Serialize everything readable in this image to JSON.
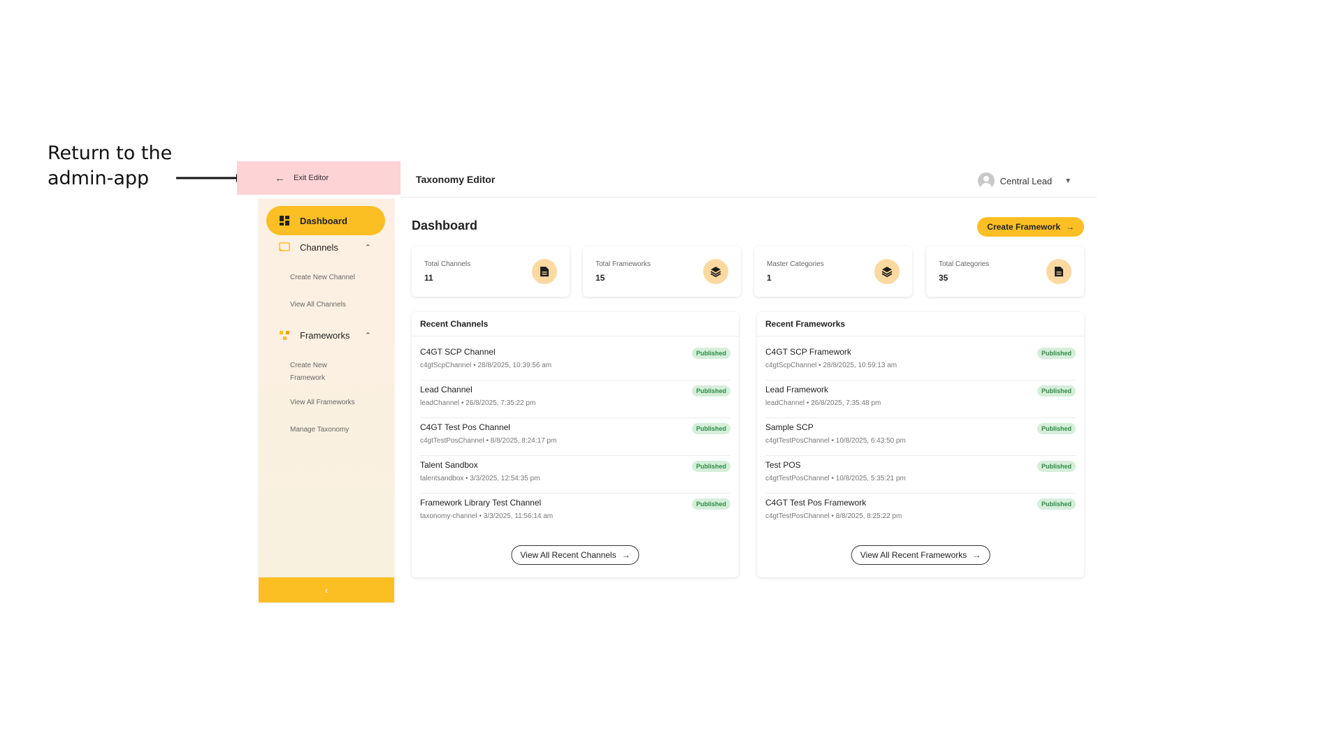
{
  "annotation": {
    "text": "Return to the admin-app"
  },
  "exit_editor": {
    "label": "Exit Editor",
    "icon": "arrow-left-icon"
  },
  "header": {
    "title": "Taxonomy Editor",
    "user_name": "Central Lead"
  },
  "sidebar": {
    "dashboard": "Dashboard",
    "channels": {
      "label": "Channels",
      "sub": [
        "Create New Channel",
        "View All Channels"
      ]
    },
    "frameworks": {
      "label": "Frameworks",
      "sub": [
        "Create New Framework",
        "View All Frameworks",
        "Manage Taxonomy"
      ]
    },
    "collapse_icon": "chevron-left-icon"
  },
  "main": {
    "title": "Dashboard",
    "create_button": "Create Framework",
    "stats": [
      {
        "label": "Total Channels",
        "value": "11",
        "icon": "document-icon"
      },
      {
        "label": "Total Frameworks",
        "value": "15",
        "icon": "layers-icon"
      },
      {
        "label": "Master Categories",
        "value": "1",
        "icon": "layers-icon"
      },
      {
        "label": "Total Categories",
        "value": "35",
        "icon": "document-icon"
      }
    ],
    "recent_channels": {
      "title": "Recent Channels",
      "button": "View All Recent Channels",
      "items": [
        {
          "name": "C4GT SCP Channel",
          "meta": "c4gtScpChannel • 28/8/2025, 10:39:56 am",
          "status": "Published"
        },
        {
          "name": "Lead Channel",
          "meta": "leadChannel • 26/8/2025, 7:35:22 pm",
          "status": "Published"
        },
        {
          "name": "C4GT Test Pos Channel",
          "meta": "c4gtTestPosChannel • 8/8/2025, 8:24:17 pm",
          "status": "Published"
        },
        {
          "name": "Talent Sandbox",
          "meta": "talentsandbox • 3/3/2025, 12:54:35 pm",
          "status": "Published"
        },
        {
          "name": "Framework Library Test Channel",
          "meta": "taxonomy-channel • 3/3/2025, 11:56:14 am",
          "status": "Published"
        }
      ]
    },
    "recent_frameworks": {
      "title": "Recent Frameworks",
      "button": "View All Recent Frameworks",
      "items": [
        {
          "name": "C4GT SCP Framework",
          "meta": "c4gtScpChannel • 28/8/2025, 10:59:13 am",
          "status": "Published"
        },
        {
          "name": "Lead Framework",
          "meta": "leadChannel • 26/8/2025, 7:35:48 pm",
          "status": "Published"
        },
        {
          "name": "Sample SCP",
          "meta": "c4gtTestPosChannel • 10/8/2025, 6:43:50 pm",
          "status": "Published"
        },
        {
          "name": "Test POS",
          "meta": "c4gtTestPosChannel • 10/8/2025, 5:35:21 pm",
          "status": "Published"
        },
        {
          "name": "C4GT Test Pos Framework",
          "meta": "c4gtTestPosChannel • 8/8/2025, 8:25:22 pm",
          "status": "Published"
        }
      ]
    }
  }
}
